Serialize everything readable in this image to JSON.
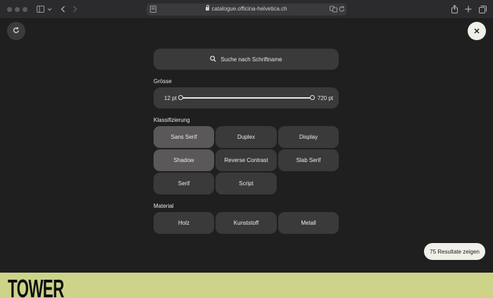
{
  "browser": {
    "url": "catalogue.officina-helvetica.ch",
    "icons": {
      "sidebar": "sidebar-icon",
      "back": "back-arrow-icon",
      "forward": "forward-arrow-icon",
      "share": "share-icon",
      "new_tab": "plus-icon",
      "tabs": "tabs-overview-icon"
    }
  },
  "filter": {
    "search_placeholder": "Suche nach Schriftname",
    "size": {
      "label": "Grösse",
      "min_label": "12 pt",
      "max_label": "720 pt",
      "min_value": 12,
      "max_value": 720
    },
    "classification": {
      "label": "Klassifizierung",
      "options": [
        {
          "label": "Sans Serif",
          "selected": true
        },
        {
          "label": "Duplex",
          "selected": false
        },
        {
          "label": "Display",
          "selected": false
        },
        {
          "label": "Shadow",
          "selected": true
        },
        {
          "label": "Reverse Contrast",
          "selected": false
        },
        {
          "label": "Slab Serif",
          "selected": false
        },
        {
          "label": "Serif",
          "selected": false
        },
        {
          "label": "Script",
          "selected": false
        }
      ]
    },
    "material": {
      "label": "Material",
      "options": [
        {
          "label": "Holz",
          "selected": false
        },
        {
          "label": "Kunststoff",
          "selected": false
        },
        {
          "label": "Metall",
          "selected": false
        }
      ]
    },
    "results_button": "75 Resultate zeigen"
  },
  "preview": {
    "text": "TOWER",
    "background": "#cdd48a"
  },
  "colors": {
    "background": "#1f1f1f",
    "panel": "#3a3a3a",
    "selected": "#5a5858",
    "light_button": "#f1efe9"
  }
}
